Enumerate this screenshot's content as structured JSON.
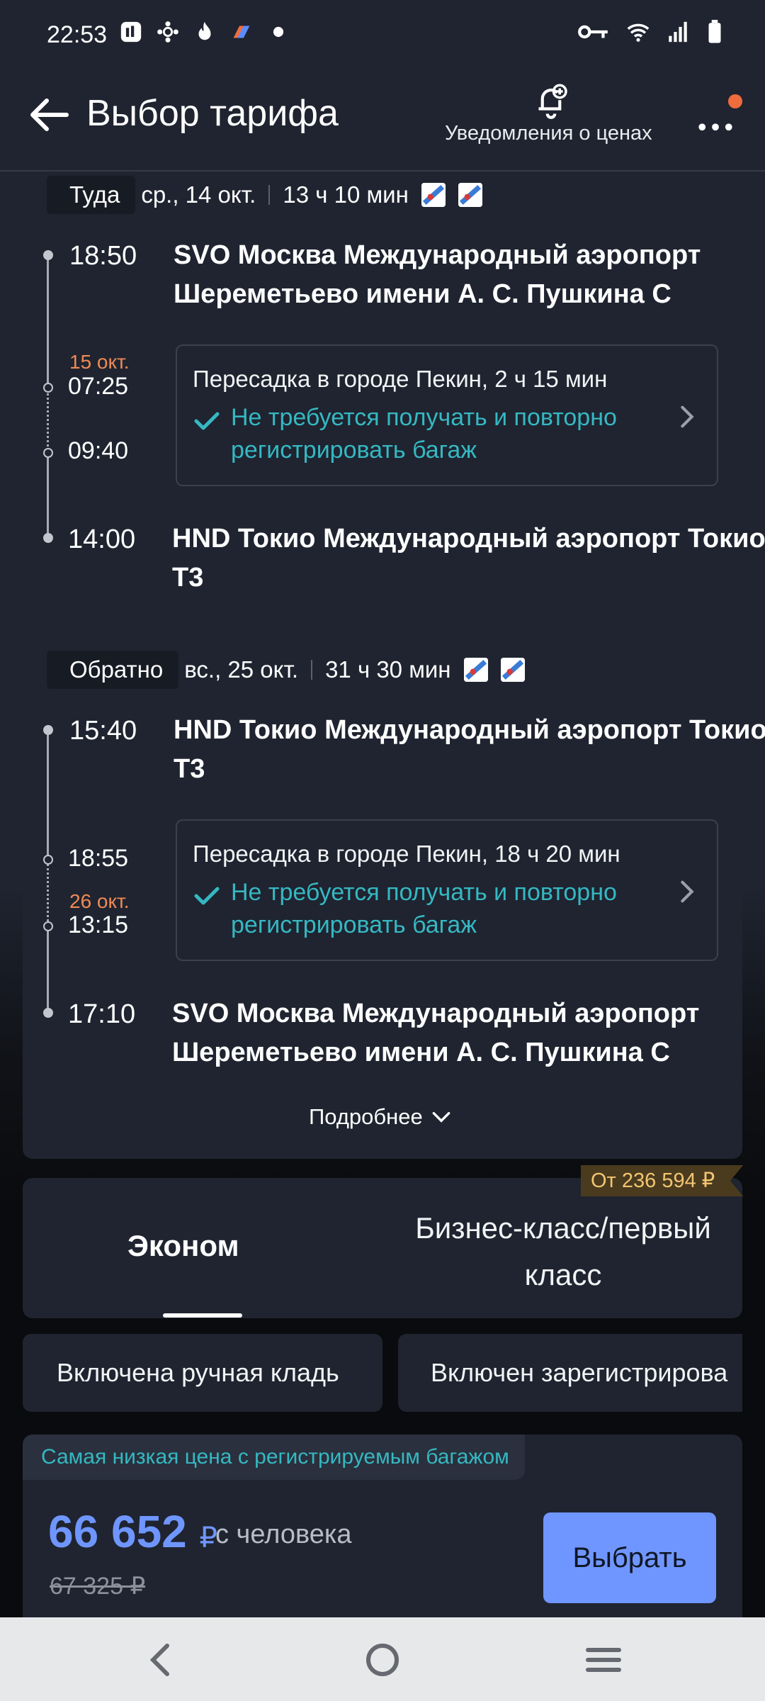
{
  "status_bar": {
    "time": "22:53",
    "left_icons": [
      "app-badge-icon",
      "settings-flower-icon",
      "flame-icon",
      "app-logo-icon",
      "dot-icon"
    ],
    "right_icons": [
      "key-icon",
      "wifi-icon",
      "signal-icon",
      "battery-icon"
    ]
  },
  "header": {
    "title": "Выбор тарифа",
    "notifications_label": "Уведомления о ценах",
    "has_unread_dot": true
  },
  "outbound": {
    "direction": "Туда",
    "date": "ср., 14 окт.",
    "duration": "13 ч 10 мин",
    "departure_time": "18:50",
    "departure_airport": "SVO Москва Международный аэропорт Шереметьево имени А. С. Пушкина С",
    "transfer_arrive_date": "15 окт.",
    "transfer_arrive_time": "07:25",
    "transfer_depart_time": "09:40",
    "transfer_title": "Пересадка в городе Пекин, 2 ч 15 мин",
    "transfer_note": "Не требуется получать и повторно регистрировать багаж",
    "arrival_time": "14:00",
    "arrival_airport": "HND Токио Международный аэропорт Токио T3"
  },
  "return": {
    "direction": "Обратно",
    "date": "вс., 25 окт.",
    "duration": "31 ч 30 мин",
    "departure_time": "15:40",
    "departure_airport": "HND Токио Международный аэропорт Токио T3",
    "transfer_arrive_time": "18:55",
    "transfer_depart_date": "26 окт.",
    "transfer_depart_time": "13:15",
    "transfer_title": "Пересадка в городе Пекин, 18 ч 20 мин",
    "transfer_note": "Не требуется получать и повторно регистрировать багаж",
    "arrival_time": "17:10",
    "arrival_airport": "SVO Москва Международный аэропорт Шереметьево имени А. С. Пушкина С"
  },
  "more_details_label": "Подробнее",
  "price_tag": "От 236 594 ₽",
  "class_tabs": {
    "economy": "Эконом",
    "business": "Бизнес-класс/первый класс",
    "selected": "economy"
  },
  "filters": [
    "Включена ручная кладь",
    "Включен зарегистрирова"
  ],
  "fare": {
    "badge": "Самая низкая цена с регистрируемым багажом",
    "price": "66 652",
    "currency": "₽",
    "per_person": "с человека",
    "old_price": "67 325 ₽",
    "select_label": "Выбрать"
  },
  "colors": {
    "background": "#1f2430",
    "accent_blue": "#6f96ff",
    "teal": "#35b8c2",
    "orange": "#f08a55"
  }
}
